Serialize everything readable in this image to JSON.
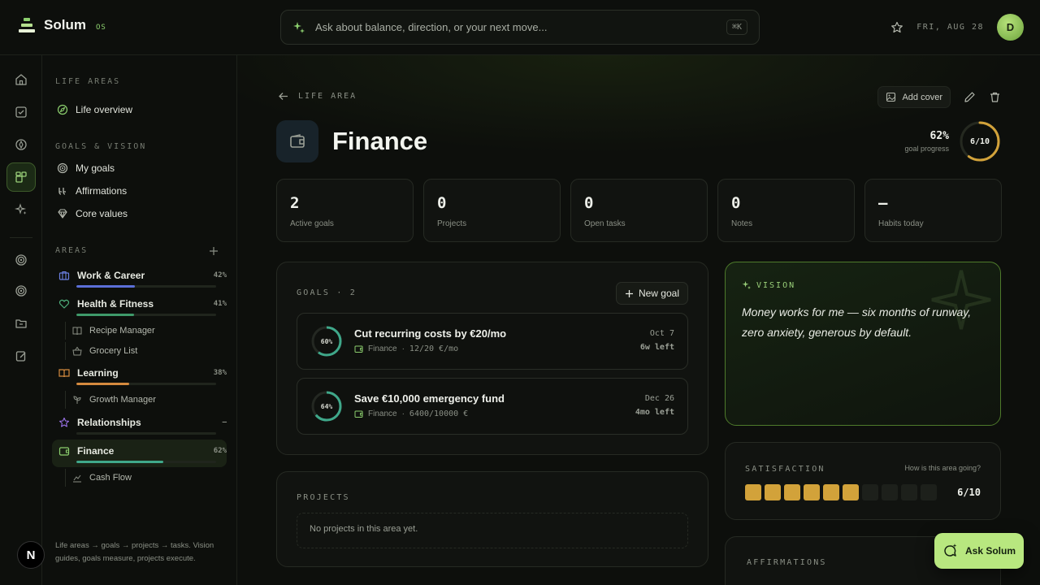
{
  "app": {
    "name": "Solum",
    "suffix": "OS"
  },
  "search": {
    "placeholder": "Ask about balance, direction, or your next move...",
    "shortcut": "⌘K"
  },
  "header": {
    "date": "FRI, AUG 28",
    "avatar_initial": "D"
  },
  "sidebar": {
    "life_areas_title": "LIFE AREAS",
    "life_overview": "Life overview",
    "goals_vision_title": "GOALS & VISION",
    "goals_vision_items": [
      "My goals",
      "Affirmations",
      "Core values"
    ],
    "areas_title": "AREAS",
    "areas": [
      {
        "label": "Work & Career",
        "pct": "42%",
        "progress": 0.42,
        "color": "#5b6fd8"
      },
      {
        "label": "Health & Fitness",
        "pct": "41%",
        "progress": 0.41,
        "color": "#3f9a6a"
      },
      {
        "label": "Learning",
        "pct": "38%",
        "progress": 0.38,
        "color": "#d48a3e"
      },
      {
        "label": "Relationships",
        "pct": "–",
        "progress": 0,
        "color": "#8a62d6"
      },
      {
        "label": "Finance",
        "pct": "62%",
        "progress": 0.62,
        "color": "#3fa88a"
      }
    ],
    "subitems": {
      "health": [
        "Recipe Manager",
        "Grocery List"
      ],
      "learning": [
        "Growth Manager"
      ],
      "finance": [
        "Cash Flow"
      ]
    },
    "footer": "Life areas → goals → projects → tasks. Vision guides, goals measure, projects execute."
  },
  "page": {
    "breadcrumb": "LIFE AREA",
    "title": "Finance",
    "add_cover": "Add cover",
    "goal_progress_pct": "62%",
    "goal_progress_label": "goal progress",
    "score": "6/10",
    "score_fraction": 0.6
  },
  "stats": [
    {
      "value": "2",
      "label": "Active goals"
    },
    {
      "value": "0",
      "label": "Projects"
    },
    {
      "value": "0",
      "label": "Open tasks"
    },
    {
      "value": "0",
      "label": "Notes"
    },
    {
      "value": "–",
      "label": "Habits today"
    }
  ],
  "goals": {
    "title": "GOALS · 2",
    "new_goal": "New goal",
    "items": [
      {
        "name": "Cut recurring costs by €20/mo",
        "area": "Finance",
        "metric": "12/20 €/mo",
        "pct": "60%",
        "progress": 0.6,
        "date": "Oct 7",
        "left": "6w left"
      },
      {
        "name": "Save €10,000 emergency fund",
        "area": "Finance",
        "metric": "6400/10000 €",
        "pct": "64%",
        "progress": 0.64,
        "date": "Dec 26",
        "left": "4mo left"
      }
    ]
  },
  "projects": {
    "title": "PROJECTS",
    "empty": "No projects in this area yet."
  },
  "vision": {
    "title": "VISION",
    "text": "Money works for me — six months of runway, zero anxiety, generous by default."
  },
  "satisfaction": {
    "title": "SATISFACTION",
    "question": "How is this area going?",
    "value": "6/10",
    "score": 6,
    "max": 10
  },
  "affirmations": {
    "title": "AFFIRMATIONS"
  },
  "ask_button": "Ask Solum",
  "colors": {
    "accent": "#b8e77f",
    "satisfaction": "#d2a23a",
    "goal_ring": "#3fa88a",
    "score_ring": "#d2a23a"
  }
}
